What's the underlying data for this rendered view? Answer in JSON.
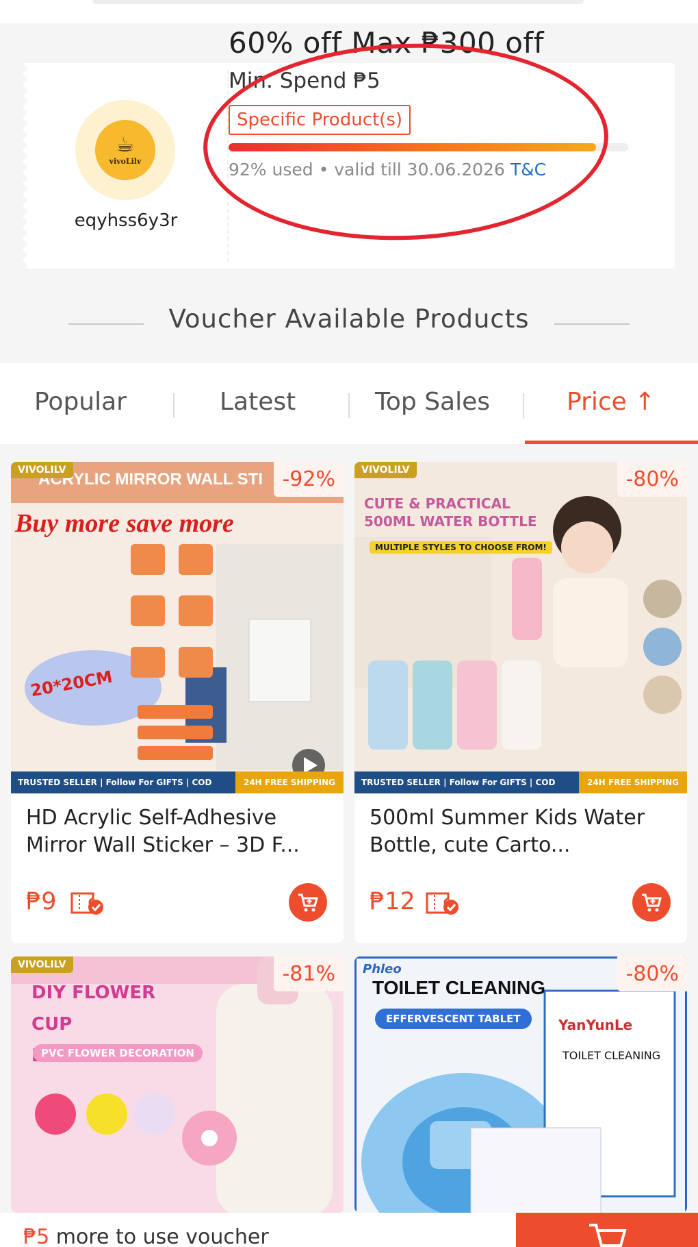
{
  "voucher": {
    "shop_name": "eqyhss6y3r",
    "logo_text": "vivoLilv",
    "title": "60% off Max ₱300 off",
    "min_spend": "Min. Spend ₱5",
    "tag": "Specific Product(s)",
    "used_fraction": 0.92,
    "usage_text": "92% used • valid till 30.06.2026",
    "tc_label": "T&C"
  },
  "section_title": "Voucher Available Products",
  "tabs": [
    {
      "label": "Popular"
    },
    {
      "label": "Latest"
    },
    {
      "label": "Top Sales"
    },
    {
      "label": "Price ↑",
      "active": true
    }
  ],
  "products": [
    {
      "name": "HD Acrylic Self-Adhesive Mirror Wall Sticker – 3D F...",
      "price": "₱9",
      "discount": "-92%",
      "shop_badge": "VIVOLILV",
      "img_headline": "ACRYLIC MIRROR WALL STI",
      "img_sub": "Buy more save more",
      "img_size": "20*20CM",
      "trust_text": "TRUSTED SELLER | Follow For GIFTS | COD",
      "trust_free": "24H FREE SHIPPING"
    },
    {
      "name": "500ml Summer Kids Water Bottle, cute Carto...",
      "price": "₱12",
      "discount": "-80%",
      "shop_badge": "VIVOLILV",
      "img_headline": "CUTE & PRACTICAL 500ML WATER BOTTLE",
      "img_sub": "MULTIPLE STYLES TO CHOOSE FROM!",
      "trust_text": "TRUSTED SELLER | Follow For GIFTS | COD",
      "trust_free": "24H FREE SHIPPING"
    },
    {
      "discount": "-81%",
      "shop_badge": "VIVOLILV",
      "img_headline": "DIY FLOWER CUP DECORATION",
      "img_sub": "PVC FLOWER DECORATION"
    },
    {
      "discount": "-80%",
      "img_brand": "Phleo",
      "img_headline": "TOILET CLEANING",
      "img_sub": "EFFERVESCENT TABLET",
      "img_box_brand": "YanYunLe",
      "img_box_text": "TOILET CLEANING"
    }
  ],
  "bottom": {
    "currency": "₱5",
    "text": "more to use voucher"
  },
  "colors": {
    "accent": "#ee4d2d",
    "link": "#1d6fc7",
    "circle": "#e2252e"
  }
}
